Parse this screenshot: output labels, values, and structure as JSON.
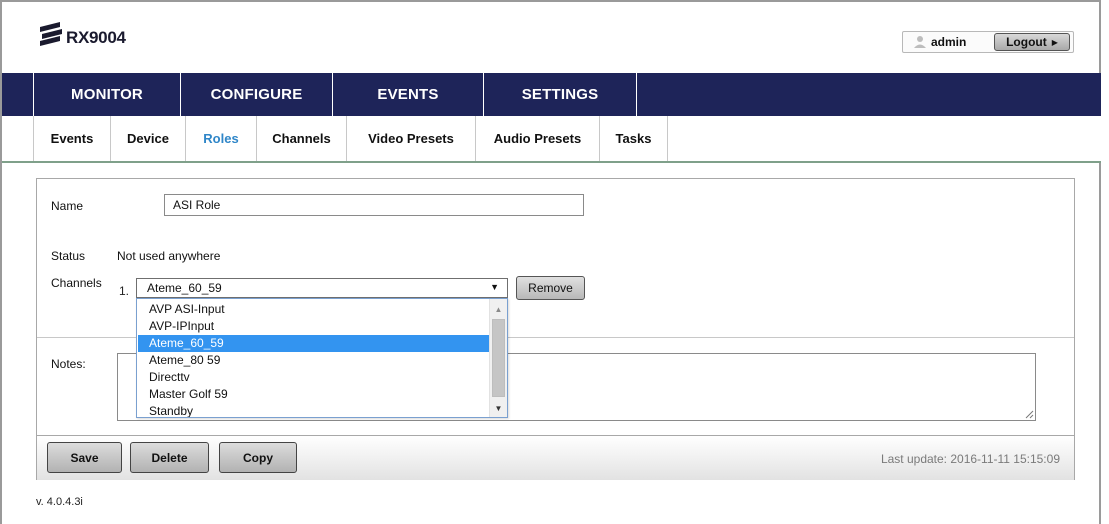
{
  "app": {
    "logo_text": "RX9004"
  },
  "user": {
    "username": "admin",
    "logout_label": "Logout"
  },
  "main_nav": [
    {
      "label": "MONITOR"
    },
    {
      "label": "CONFIGURE"
    },
    {
      "label": "EVENTS"
    },
    {
      "label": "SETTINGS"
    }
  ],
  "sub_nav": [
    {
      "label": "Events",
      "active": false
    },
    {
      "label": "Device",
      "active": false
    },
    {
      "label": "Roles",
      "active": true
    },
    {
      "label": "Channels",
      "active": false
    },
    {
      "label": "Video Presets",
      "active": false
    },
    {
      "label": "Audio Presets",
      "active": false
    },
    {
      "label": "Tasks",
      "active": false
    }
  ],
  "form": {
    "name_label": "Name",
    "name_value": "ASI Role",
    "status_label": "Status",
    "status_value": "Not used anywhere",
    "channels_label": "Channels",
    "channel_index": "1.",
    "channel_selected": "Ateme_60_59",
    "remove_label": "Remove",
    "notes_label": "Notes:"
  },
  "dropdown": {
    "options": [
      "AVP ASI-Input",
      "AVP-IPInput",
      "Ateme_60_59",
      "Ateme_80 59",
      "Directtv",
      "Master Golf 59",
      "Standby"
    ],
    "selected_index": 2
  },
  "actions": {
    "save_label": "Save",
    "delete_label": "Delete",
    "copy_label": "Copy",
    "last_update": "Last update: 2016-11-11 15:15:09"
  },
  "footer": {
    "version": "v. 4.0.4.3i"
  },
  "colors": {
    "nav_bg": "#1e2459",
    "active_tab": "#2f86c8",
    "selected_option": "#3394f0",
    "subnav_underline": "#7fa08a"
  }
}
